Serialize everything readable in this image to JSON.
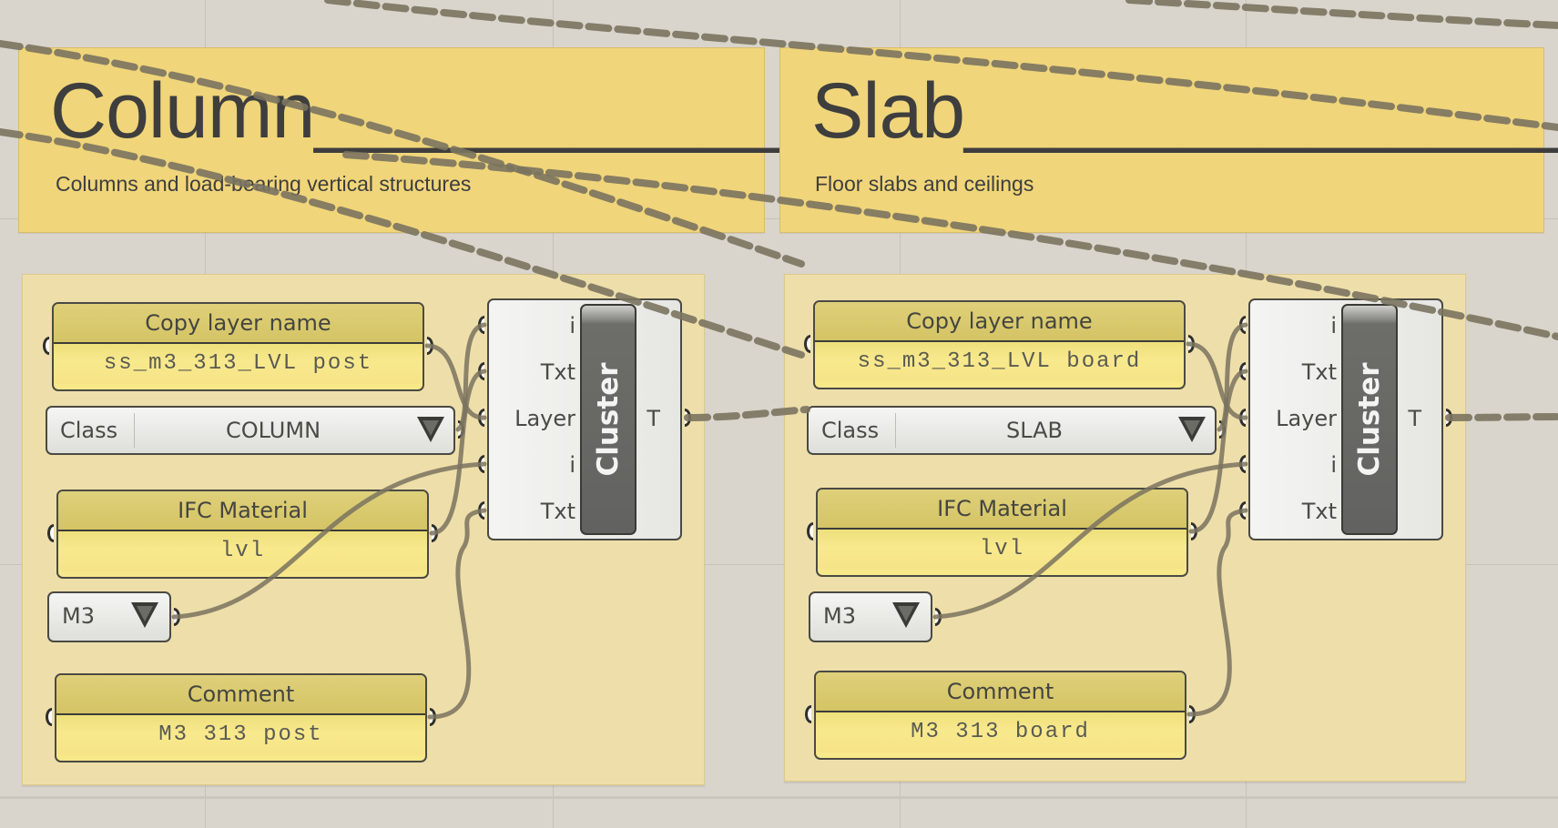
{
  "canvas": {
    "background": "#d9d5cc",
    "group_color": "#eedfaa",
    "scribble_color": "#f0d57a",
    "wire_color": "#7a735f"
  },
  "sections": [
    {
      "id": "column",
      "title": "Column___________",
      "subtitle": "Columns and load-bearing vertical structures",
      "copy_layer": {
        "label": "Copy layer name",
        "value": "ss_m3_313_LVL post"
      },
      "class_list": {
        "label": "Class",
        "value": "COLUMN"
      },
      "ifc_material": {
        "label": "IFC Material",
        "value": "lvl"
      },
      "m3_list": {
        "value": "M3"
      },
      "comment": {
        "label": "Comment",
        "value": "M3 313 post"
      },
      "cluster": {
        "label": "Cluster",
        "inputs": [
          "i",
          "Txt",
          "Layer",
          "i",
          "Txt"
        ],
        "output": "T"
      }
    },
    {
      "id": "slab",
      "title": "Slab______________",
      "subtitle": "Floor slabs and ceilings",
      "copy_layer": {
        "label": "Copy layer name",
        "value": "ss_m3_313_LVL board"
      },
      "class_list": {
        "label": "Class",
        "value": "SLAB"
      },
      "ifc_material": {
        "label": "IFC Material",
        "value": "lvl"
      },
      "m3_list": {
        "value": "M3"
      },
      "comment": {
        "label": "Comment",
        "value": "M3 313 board"
      },
      "cluster": {
        "label": "Cluster",
        "inputs": [
          "i",
          "Txt",
          "Layer",
          "i",
          "Txt"
        ],
        "output": "T"
      }
    }
  ]
}
